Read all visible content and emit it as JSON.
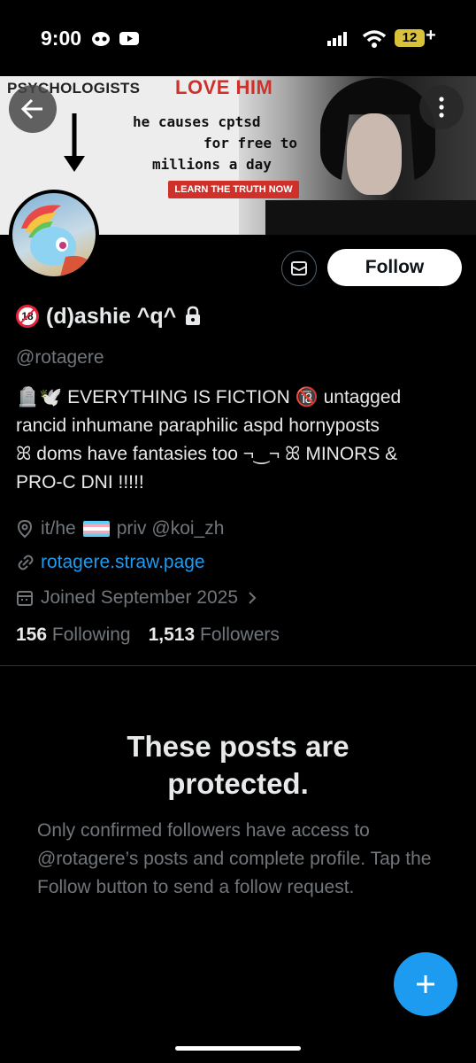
{
  "status_bar": {
    "time": "9:00",
    "battery": "12"
  },
  "banner": {
    "headline_1": "PSYCHOLOGISTS",
    "headline_2": "LOVE HIM",
    "line_1": "he causes cptsd",
    "line_2": "for free to",
    "line_3": "millions a day",
    "cta": "LEARN THE TRUTH NOW"
  },
  "profile": {
    "display_name": "(d)ashie ^q^",
    "age_badge": "18",
    "handle": "@rotagere",
    "bio": [
      "🪦🕊️ EVERYTHING IS FICTION 🔞 untagged",
      "rancid inhumane paraphilic aspd hornyposts",
      "ꕤ doms have fantasies too ¬‿¬ ꕤ MINORS &",
      "PRO-C DNI !!!!!"
    ],
    "location_pre": "it/he",
    "location_post": "priv @koi_zh",
    "website": "rotagere.straw.page",
    "joined": "Joined September 2025",
    "following_count": "156",
    "following_label": "Following",
    "followers_count": "1,513",
    "followers_label": "Followers"
  },
  "actions": {
    "follow_label": "Follow"
  },
  "protected": {
    "title_line_1": "These posts are",
    "title_line_2": "protected.",
    "body": "Only confirmed followers have access to @rotagere’s posts and complete profile. Tap the Follow button to send a follow request."
  },
  "colors": {
    "accent": "#1d9bf0",
    "muted": "#71767b",
    "text": "#e7e9ea",
    "background": "#000000"
  }
}
